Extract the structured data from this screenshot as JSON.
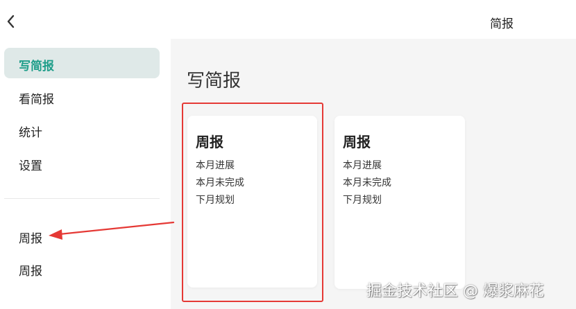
{
  "header": {
    "title": "简报",
    "back_icon": "chevron-left-icon"
  },
  "sidebar": {
    "items": [
      {
        "label": "写简报",
        "active": true
      },
      {
        "label": "看简报"
      },
      {
        "label": "统计"
      },
      {
        "label": "设置"
      }
    ],
    "templates": [
      {
        "label": "周报"
      },
      {
        "label": "周报"
      }
    ]
  },
  "main": {
    "title": "写简报",
    "cards": [
      {
        "title": "周报",
        "lines": [
          "本月进展",
          "本月未完成",
          "下月规划"
        ]
      },
      {
        "title": "周报",
        "lines": [
          "本月进展",
          "本月未完成",
          "下月规划"
        ]
      }
    ]
  },
  "colors": {
    "accent": "#1f9e8a",
    "active_bg": "#dfe9e8",
    "annotation": "#e53935",
    "main_bg": "#f5f5f5"
  },
  "watermark": "掘金技术社区 @ 爆浆麻花"
}
